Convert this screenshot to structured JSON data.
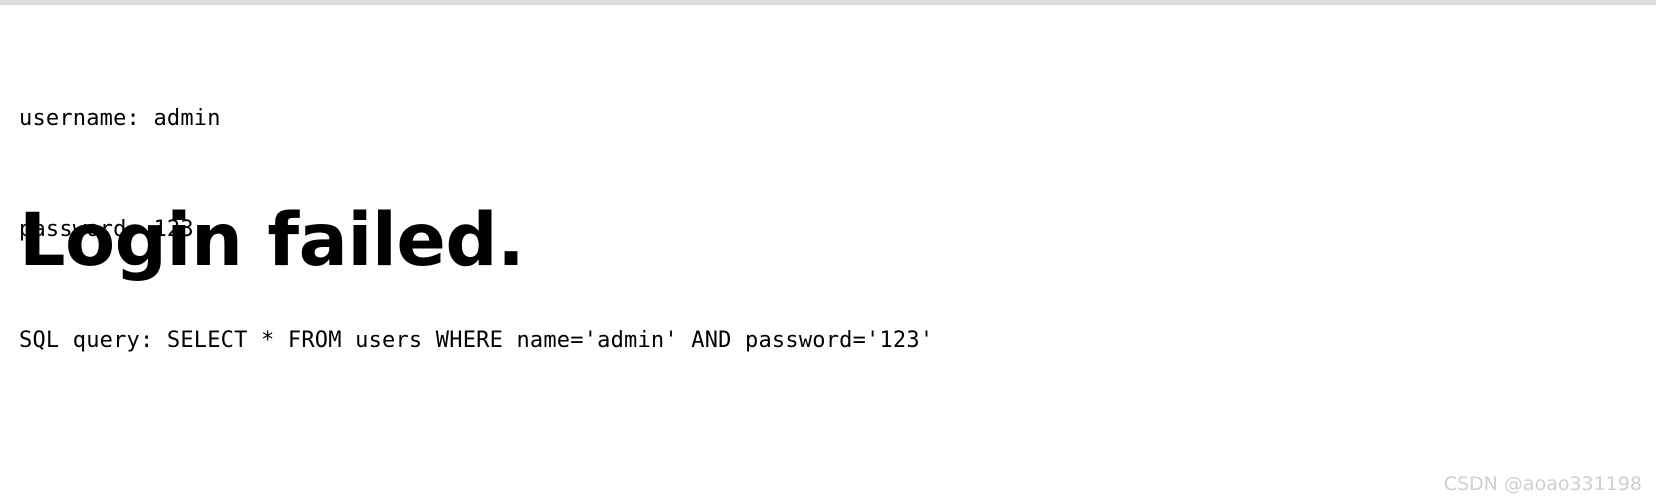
{
  "page": {
    "background_color": "#ffffff",
    "top_rule_color": "#dcdcdc"
  },
  "output": {
    "lines": [
      "username: admin",
      "password: 123",
      "SQL query: SELECT * FROM users WHERE name='admin' AND password='123'"
    ],
    "username_line": "username: admin",
    "password_line": "password: 123",
    "sql_line": "SQL query: SELECT * FROM users WHERE name='admin' AND password='123'",
    "username_label": "username:",
    "username_value": "admin",
    "password_label": "password:",
    "password_value": "123",
    "sql_label": "SQL query:",
    "sql_statement": "SELECT * FROM users WHERE name='admin' AND password='123'"
  },
  "result": {
    "heading": "Login failed.",
    "text_color": "#000000"
  },
  "watermark": {
    "text": "CSDN @aoao331198",
    "color": "#cfcfcf"
  }
}
